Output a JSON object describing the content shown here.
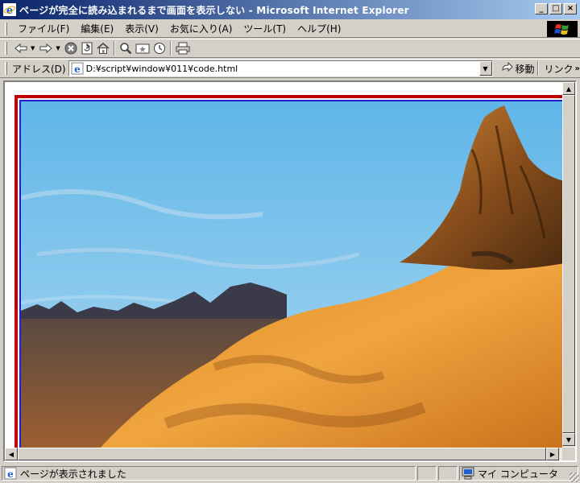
{
  "window": {
    "title": "ページが完全に読み込まれるまで画面を表示しない - Microsoft Internet Explorer",
    "minimize_label": "_",
    "maximize_label": "□",
    "close_label": "×"
  },
  "menu": {
    "items": [
      {
        "label": "ファイル(F)"
      },
      {
        "label": "編集(E)"
      },
      {
        "label": "表示(V)"
      },
      {
        "label": "お気に入り(A)"
      },
      {
        "label": "ツール(T)"
      },
      {
        "label": "ヘルプ(H)"
      }
    ]
  },
  "toolbar": {
    "buttons": [
      "back-icon",
      "forward-icon",
      "stop-icon",
      "refresh-icon",
      "home-icon",
      "search-icon",
      "favorites-icon",
      "history-icon",
      "print-icon"
    ]
  },
  "address": {
    "label": "アドレス(D)",
    "value": "D:¥script¥window¥011¥code.html",
    "go_label": "移動",
    "links_label": "リンク",
    "links_more": "»"
  },
  "content": {
    "image_description_icon": "desert-mountain-landscape",
    "frame_outer_color": "#c00000",
    "frame_inner_color": "#2020d0"
  },
  "status": {
    "text": "ページが表示されました",
    "zone": "マイ コンピュータ"
  }
}
